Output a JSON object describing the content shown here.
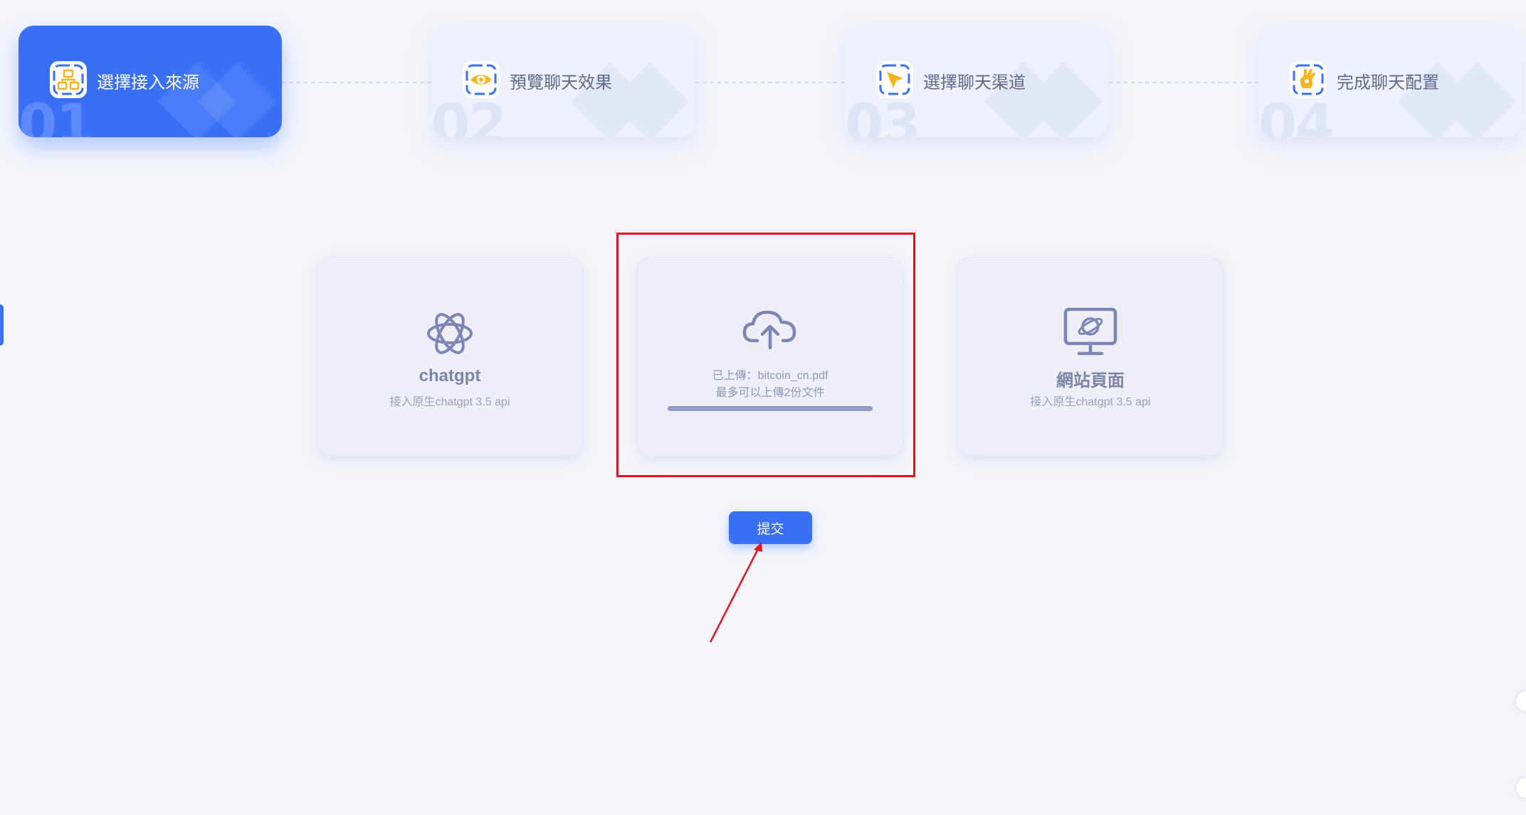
{
  "steps": [
    {
      "number": "01",
      "label": "選擇接入來源",
      "icon": "sitemap-icon",
      "active": true
    },
    {
      "number": "02",
      "label": "預覽聊天效果",
      "icon": "eye-icon",
      "active": false
    },
    {
      "number": "03",
      "label": "選擇聊天渠道",
      "icon": "cursor-arrow-icon",
      "active": false
    },
    {
      "number": "04",
      "label": "完成聊天配置",
      "icon": "ok-hand-icon",
      "active": false
    }
  ],
  "cards": {
    "chatgpt": {
      "title": "chatgpt",
      "subtitle": "接入原生chatgpt 3.5 api",
      "icon": "openai-logo-icon"
    },
    "upload": {
      "line1": "已上傳：bitcoin_cn.pdf",
      "line2": "最多可以上傳2份文件",
      "icon": "cloud-upload-icon",
      "progress": 1.0
    },
    "website": {
      "title": "網站頁面",
      "subtitle": "接入原生chatgpt 3.5 api",
      "icon": "monitor-browser-icon"
    }
  },
  "submit": {
    "label": "提交"
  },
  "colors": {
    "primary": "#3a6ff8",
    "background": "#f5f6fb",
    "annotation": "#e0141e",
    "icon_yellow": "#f2b51f"
  }
}
